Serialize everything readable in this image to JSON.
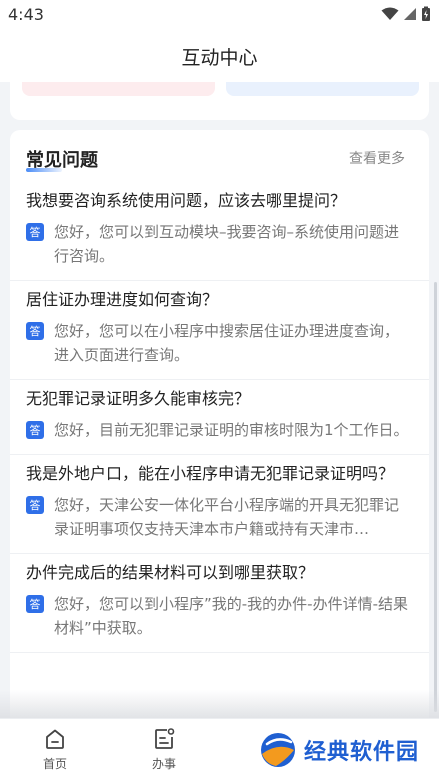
{
  "status_bar": {
    "time": "4:43"
  },
  "nav": {
    "title": "互动中心"
  },
  "faq": {
    "title": "常见问题",
    "more_label": "查看更多",
    "answer_badge": "答",
    "items": [
      {
        "question": "我想要咨询系统使用问题，应该去哪里提问？",
        "answer": "您好，您可以到互动模块–我要咨询–系统使用问题进行咨询。"
      },
      {
        "question": "居住证办理进度如何查询？",
        "answer": "您好，您可以在小程序中搜索居住证办理进度查询，进入页面进行查询。"
      },
      {
        "question": "无犯罪记录证明多久能审核完？",
        "answer": "您好，目前无犯罪记录证明的审核时限为1个工作日。"
      },
      {
        "question": "我是外地户口，能在小程序申请无犯罪记录证明吗？",
        "answer": "您好，天津公安一体化平台小程序端的开具无犯罪记录证明事项仅支持天津本市户籍或持有天津市…"
      },
      {
        "question": "办件完成后的结果材料可以到哪里获取？",
        "answer": "您好，您可以到小程序”我的-我的办件-办件详情-结果材料”中获取。"
      }
    ]
  },
  "tabs": {
    "home_label": "首页",
    "service_label": "办事"
  },
  "watermark": {
    "text": "经典软件园"
  },
  "colors": {
    "accent": "#2f6fe8",
    "badge": "#2f6fe8"
  }
}
